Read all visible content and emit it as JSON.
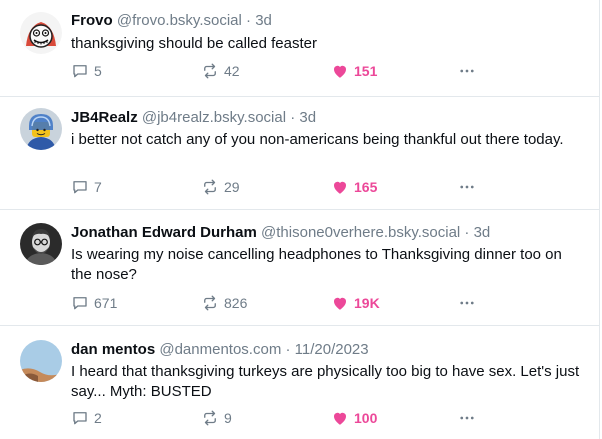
{
  "posts": [
    {
      "name": "Frovo",
      "handle": "@frovo.bsky.social",
      "sep": "·",
      "time": "3d",
      "text": "thanksgiving should be called feaster",
      "replies": "5",
      "reposts": "42",
      "likes": "151"
    },
    {
      "name": "JB4Realz",
      "handle": "@jb4realz.bsky.social",
      "sep": "·",
      "time": "3d",
      "text": "i better not catch any of you non-americans being thankful  out there today.",
      "replies": "7",
      "reposts": "29",
      "likes": "165"
    },
    {
      "name": "Jonathan Edward Durham",
      "handle": "@thisone0verhere.bsky.social",
      "sep": "·",
      "time": "3d",
      "text": "Is wearing my noise cancelling headphones to Thanksgiving dinner too on the nose?",
      "replies": "671",
      "reposts": "826",
      "likes": "19K"
    },
    {
      "name": "dan mentos",
      "handle": "@danmentos.com",
      "sep": "·",
      "time": "11/20/2023",
      "text": "I heard that thanksgiving turkeys are physically too big to have sex. Let's just say... Myth: BUSTED",
      "replies": "2",
      "reposts": "9",
      "likes": "100"
    }
  ],
  "colors": {
    "like": "#ec4899",
    "muted": "#6f7c88",
    "divider": "#e3e8ec"
  }
}
